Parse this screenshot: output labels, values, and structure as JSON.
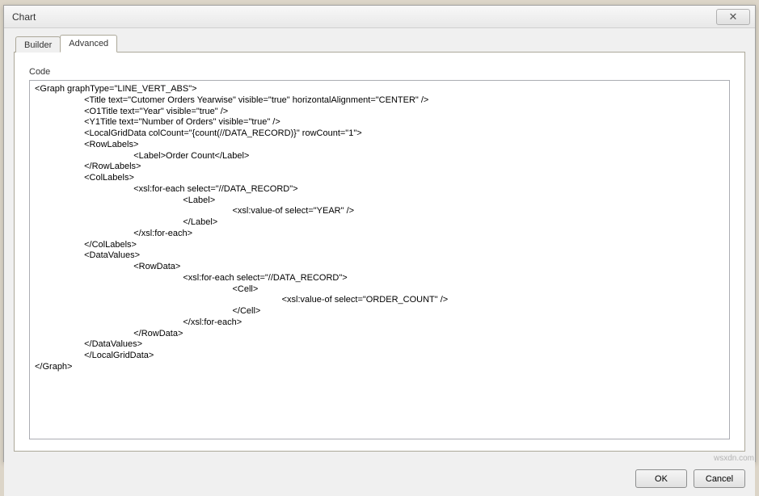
{
  "dialog": {
    "title": "Chart",
    "close_symbol": "✕"
  },
  "tabs": {
    "builder": "Builder",
    "advanced": "Advanced"
  },
  "panel": {
    "code_label": "Code",
    "code_text": "<Graph graphType=\"LINE_VERT_ABS\">\n                    <Title text=\"Cutomer Orders Yearwise\" visible=\"true\" horizontalAlignment=\"CENTER\" />\n                    <O1Title text=\"Year\" visible=\"true\" />\n                    <Y1Title text=\"Number of Orders\" visible=\"true\" />\n                    <LocalGridData colCount=\"{count(//DATA_RECORD)}\" rowCount=\"1\">\n                    <RowLabels>\n                                        <Label>Order Count</Label>\n                    </RowLabels>\n                    <ColLabels>\n                                        <xsl:for-each select=\"//DATA_RECORD\">\n                                                            <Label>\n                                                                                <xsl:value-of select=\"YEAR\" />\n                                                            </Label>\n                                        </xsl:for-each>\n                    </ColLabels>\n                    <DataValues>\n                                        <RowData>\n                                                            <xsl:for-each select=\"//DATA_RECORD\">\n                                                                                <Cell>\n                                                                                                    <xsl:value-of select=\"ORDER_COUNT\" />\n                                                                                </Cell>\n                                                            </xsl:for-each>\n                                        </RowData>\n                    </DataValues>\n                    </LocalGridData>\n</Graph>"
  },
  "buttons": {
    "ok": "OK",
    "cancel": "Cancel"
  },
  "watermark": "wsxdn.com"
}
